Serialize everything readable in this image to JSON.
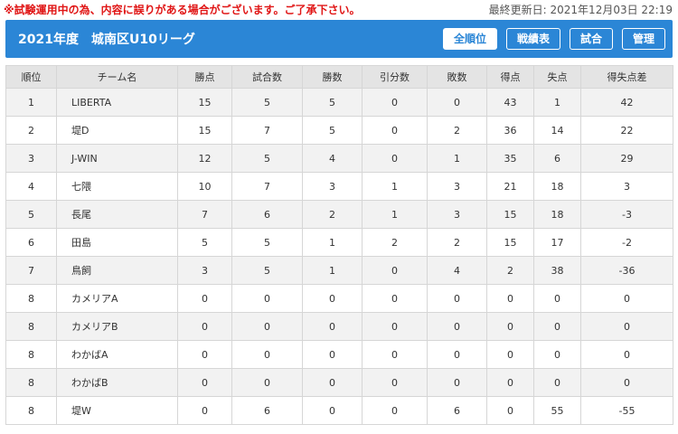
{
  "notice": "※試験運用中の為、内容に誤りがある場合がございます。ご了承下さい。",
  "last_updated": "最終更新日: 2021年12月03日 22:19",
  "header": {
    "title": "2021年度　城南区U10リーグ",
    "accent_color": "#2b86d6",
    "nav": [
      {
        "label": "全順位",
        "active": true
      },
      {
        "label": "戦績表",
        "active": false
      },
      {
        "label": "試合",
        "active": false
      },
      {
        "label": "管理",
        "active": false
      }
    ]
  },
  "table": {
    "headers": [
      "順位",
      "チーム名",
      "勝点",
      "試合数",
      "勝数",
      "引分数",
      "敗数",
      "得点",
      "失点",
      "得失点差"
    ],
    "rows": [
      [
        "1",
        "LIBERTA",
        "15",
        "5",
        "5",
        "0",
        "0",
        "43",
        "1",
        "42"
      ],
      [
        "2",
        "堤D",
        "15",
        "7",
        "5",
        "0",
        "2",
        "36",
        "14",
        "22"
      ],
      [
        "3",
        "J-WIN",
        "12",
        "5",
        "4",
        "0",
        "1",
        "35",
        "6",
        "29"
      ],
      [
        "4",
        "七隈",
        "10",
        "7",
        "3",
        "1",
        "3",
        "21",
        "18",
        "3"
      ],
      [
        "5",
        "長尾",
        "7",
        "6",
        "2",
        "1",
        "3",
        "15",
        "18",
        "-3"
      ],
      [
        "6",
        "田島",
        "5",
        "5",
        "1",
        "2",
        "2",
        "15",
        "17",
        "-2"
      ],
      [
        "7",
        "鳥飼",
        "3",
        "5",
        "1",
        "0",
        "4",
        "2",
        "38",
        "-36"
      ],
      [
        "8",
        "カメリアA",
        "0",
        "0",
        "0",
        "0",
        "0",
        "0",
        "0",
        "0"
      ],
      [
        "8",
        "カメリアB",
        "0",
        "0",
        "0",
        "0",
        "0",
        "0",
        "0",
        "0"
      ],
      [
        "8",
        "わかばA",
        "0",
        "0",
        "0",
        "0",
        "0",
        "0",
        "0",
        "0"
      ],
      [
        "8",
        "わかばB",
        "0",
        "0",
        "0",
        "0",
        "0",
        "0",
        "0",
        "0"
      ],
      [
        "8",
        "堤W",
        "0",
        "6",
        "0",
        "0",
        "6",
        "0",
        "55",
        "-55"
      ]
    ]
  }
}
